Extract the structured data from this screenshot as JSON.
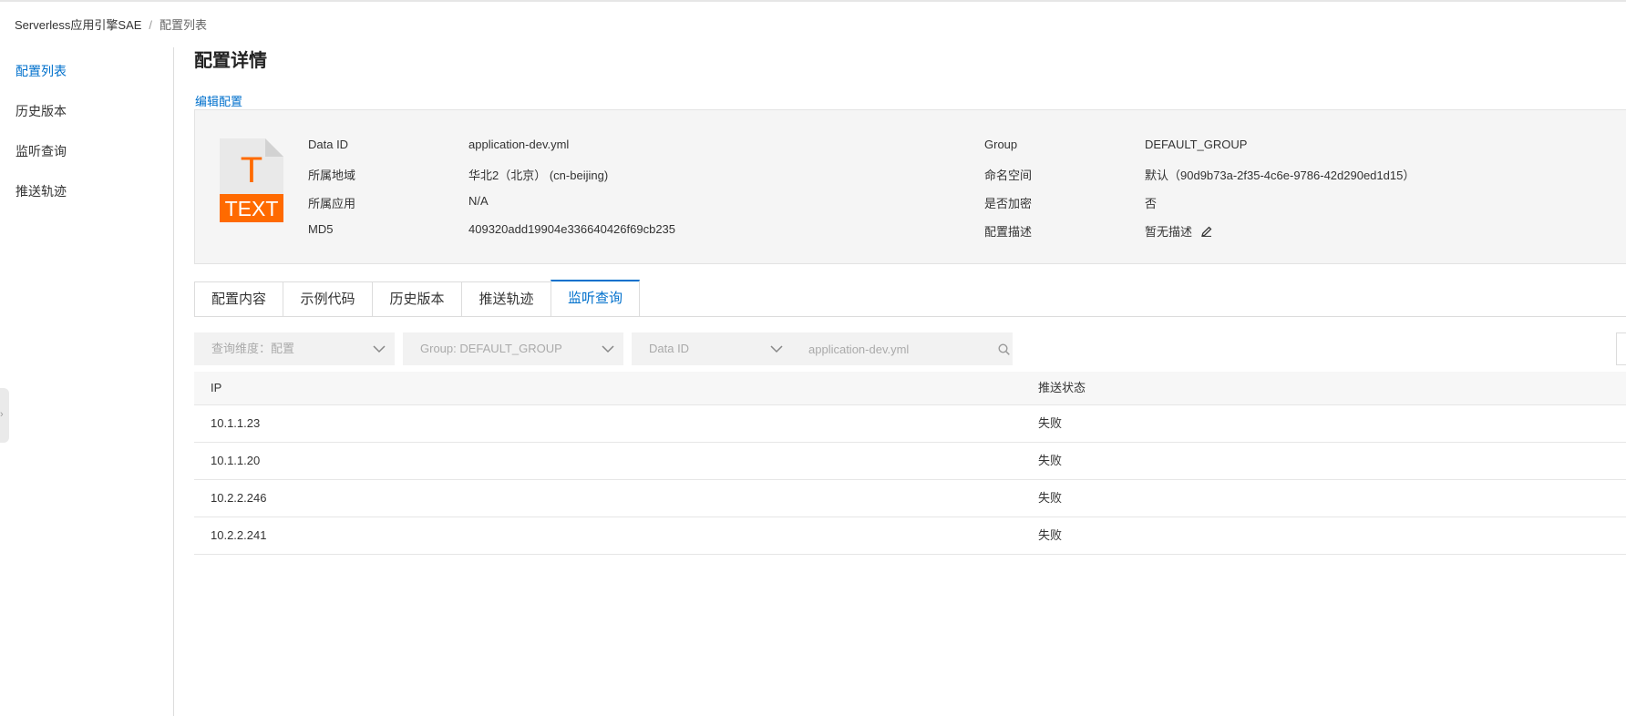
{
  "breadcrumb": {
    "root": "Serverless应用引擎SAE",
    "separator": "/",
    "current": "配置列表"
  },
  "sidebar": {
    "items": [
      {
        "label": "配置列表",
        "active": true
      },
      {
        "label": "历史版本",
        "active": false
      },
      {
        "label": "监听查询",
        "active": false
      },
      {
        "label": "推送轨迹",
        "active": false
      }
    ]
  },
  "page": {
    "title": "配置详情",
    "edit_link": "编辑配置"
  },
  "file_icon": {
    "letter": "T",
    "label": "TEXT",
    "accent": "#ff6a00"
  },
  "info": {
    "left": [
      {
        "key": "Data ID",
        "value": "application-dev.yml"
      },
      {
        "key": "所属地域",
        "value": "华北2（北京） (cn-beijing)"
      },
      {
        "key": "所属应用",
        "value": "N/A"
      },
      {
        "key": "MD5",
        "value": "409320add19904e336640426f69cb235"
      }
    ],
    "right": [
      {
        "key": "Group",
        "value": "DEFAULT_GROUP"
      },
      {
        "key": "命名空间",
        "value": "默认（90d9b73a-2f35-4c6e-9786-42d290ed1d15）"
      },
      {
        "key": "是否加密",
        "value": "否"
      },
      {
        "key": "配置描述",
        "value": "暂无描述"
      }
    ],
    "edit_icon": "pencil-icon"
  },
  "tabs": [
    {
      "label": "配置内容",
      "active": false
    },
    {
      "label": "示例代码",
      "active": false
    },
    {
      "label": "历史版本",
      "active": false
    },
    {
      "label": "推送轨迹",
      "active": false
    },
    {
      "label": "监听查询",
      "active": true
    }
  ],
  "filters": {
    "dimension": "查询维度：配置",
    "group": "Group: DEFAULT_GROUP",
    "key_type": "Data ID",
    "search_placeholder": "application-dev.yml"
  },
  "table": {
    "columns": [
      "IP",
      "推送状态"
    ],
    "rows": [
      [
        "10.1.1.23",
        "失败"
      ],
      [
        "10.1.1.20",
        "失败"
      ],
      [
        "10.2.2.246",
        "失败"
      ],
      [
        "10.2.2.241",
        "失败"
      ]
    ]
  },
  "colors": {
    "primary": "#0070cc",
    "panel_bg": "#f5f5f5",
    "accent": "#ff6a00"
  }
}
